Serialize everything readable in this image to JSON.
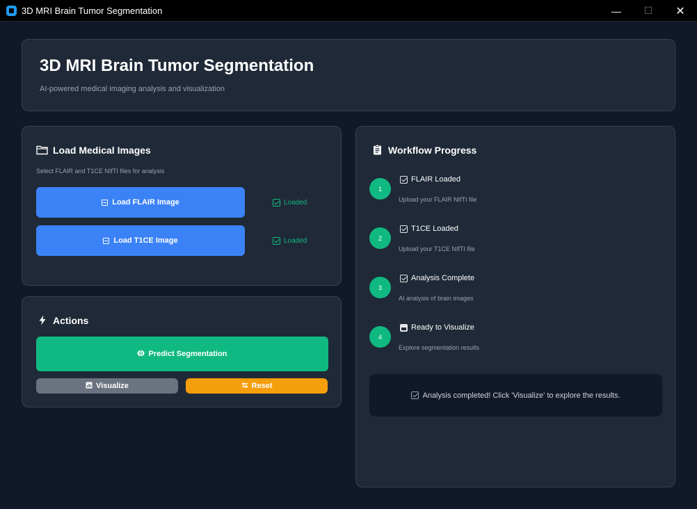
{
  "window": {
    "title": "3D MRI Brain Tumor Segmentation",
    "minimize_glyph": "—",
    "maximize_glyph": "☐",
    "close_glyph": "✕"
  },
  "header": {
    "title": "3D MRI Brain Tumor Segmentation",
    "subtitle": "AI-powered medical imaging analysis and visualization"
  },
  "load_panel": {
    "title": "Load Medical Images",
    "icon": "folder-icon",
    "description": "Select FLAIR and T1CE NIfTI files for analysis",
    "buttons": [
      {
        "label": "Load FLAIR Image",
        "status": "Loaded"
      },
      {
        "label": "Load T1CE Image",
        "status": "Loaded"
      }
    ]
  },
  "actions_panel": {
    "title": "Actions",
    "icon": "lightning-icon",
    "predict_label": "Predict Segmentation",
    "visualize_label": "Visualize",
    "reset_label": "Reset"
  },
  "workflow_panel": {
    "title": "Workflow Progress",
    "icon": "clipboard-icon",
    "steps": [
      {
        "number": "1",
        "title": "FLAIR Loaded",
        "description": "Upload your FLAIR NIfTI file",
        "icon": "checkbox-icon"
      },
      {
        "number": "2",
        "title": "T1CE Loaded",
        "description": "Upload your T1CE NIfTI file",
        "icon": "checkbox-icon"
      },
      {
        "number": "3",
        "title": "Analysis Complete",
        "description": "AI analysis of brain images",
        "icon": "checkbox-icon"
      },
      {
        "number": "4",
        "title": "Ready to Visualize",
        "description": "Explore segmentation results",
        "icon": "chart-icon"
      }
    ],
    "message": "Analysis completed! Click 'Visualize' to explore the results."
  },
  "colors": {
    "background": "#111827",
    "card": "#1f2937",
    "primary_blue": "#3b82f6",
    "success_green": "#10b981",
    "warning_orange": "#f59e0b",
    "neutral_gray": "#6b7280"
  }
}
